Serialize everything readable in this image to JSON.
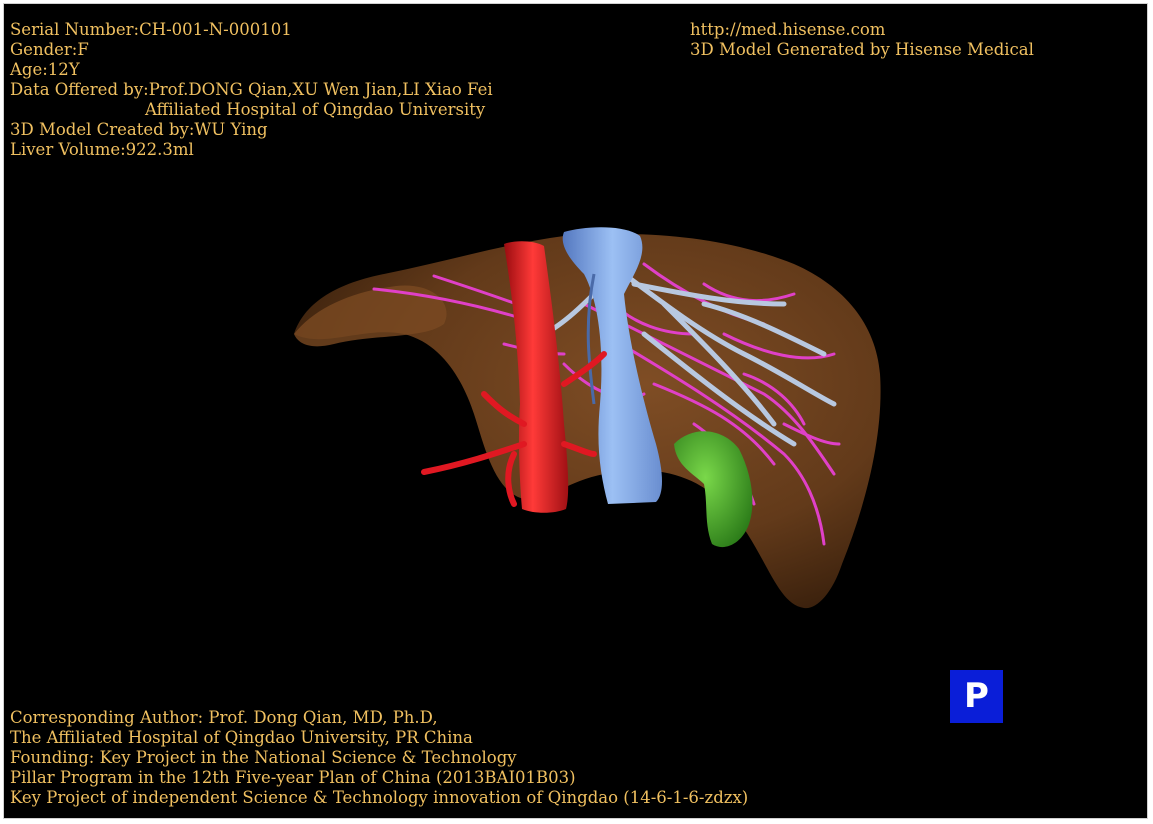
{
  "colors": {
    "background": "#000000",
    "text": "#f0c060",
    "liver": "#6b3f1c",
    "artery": "#e01822",
    "portal_vein": "#7fa8e8",
    "hepatic_vein": "#b8c8e0",
    "bile_duct": "#e040c8",
    "gallbladder": "#3cb828",
    "badge": "#0a1ed8"
  },
  "patient_info": {
    "serial": "Serial Number:CH-001-N-000101",
    "gender": "Gender:F",
    "age": "Age:12Y",
    "data_offered": "Data Offered by:Prof.DONG Qian,XU Wen Jian,LI Xiao Fei",
    "hospital": "Affiliated Hospital of Qingdao University",
    "model_created": "3D Model Created by:WU Ying",
    "liver_volume": "Liver Volume:922.3ml"
  },
  "site_info": {
    "url": "http://med.hisense.com",
    "generated": "3D Model Generated by Hisense Medical"
  },
  "credits": {
    "line1": "Corresponding Author: Prof. Dong Qian, MD, Ph.D,",
    "line2": "The Affiliated Hospital of Qingdao University, PR China",
    "line3": "Founding: Key Project in the National Science & Technology",
    "line4": "Pillar Program in the 12th Five-year Plan of China (2013BAI01B03)",
    "line5": "Key Project of independent Science & Technology innovation of Qingdao (14-6-1-6-zdzx)"
  },
  "badge": {
    "label": "P",
    "icon": "projection-mode-icon"
  }
}
